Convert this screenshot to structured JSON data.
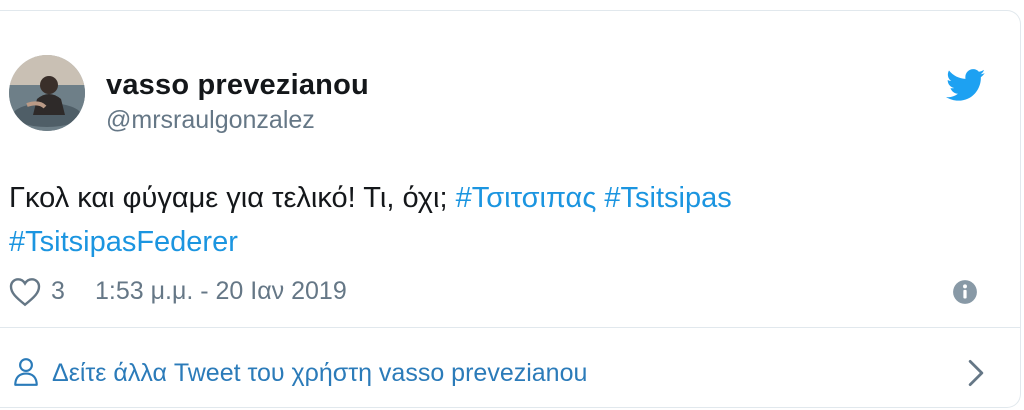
{
  "tweet": {
    "display_name": "vasso prevezianou",
    "handle": "@mrsraulgonzalez",
    "text_plain": "Γκολ και φύγαμε για τελικό! Τι, όχι; ",
    "hashtags": [
      "#Τσιτσιπας",
      "#Tsitsipas",
      "#TsitsipasFederer"
    ],
    "like_count": "3",
    "timestamp": "1:53 μ.μ. - 20 Ιαν 2019"
  },
  "footer": {
    "more_tweets_label": "Δείτε άλλα Tweet του χρήστη vasso prevezianou"
  },
  "icons": {
    "brand": "twitter-bird-icon",
    "like": "heart-icon",
    "info": "info-icon",
    "user": "person-icon",
    "next": "chevron-right-icon"
  },
  "colors": {
    "brand_blue": "#1da1f2",
    "link_blue": "#1b95e0",
    "footer_link": "#2b7bb9",
    "muted_text": "#657786",
    "border": "#e1e8ed"
  }
}
